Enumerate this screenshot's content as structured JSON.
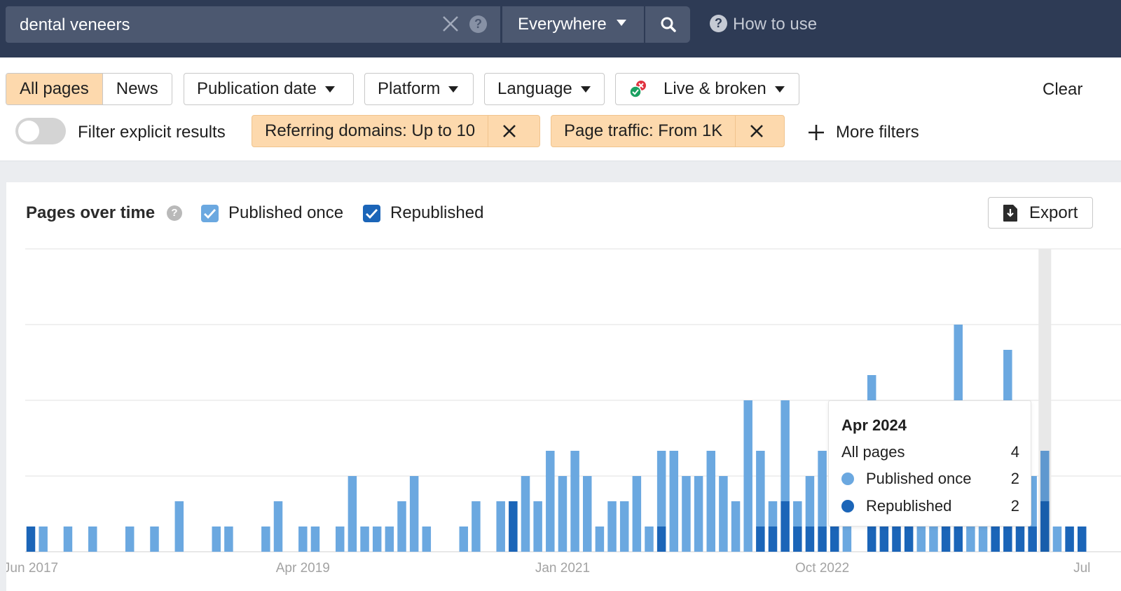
{
  "search": {
    "query": "dental veneers",
    "scope": "Everywhere",
    "how_to_use": "How to use"
  },
  "filters": {
    "segment": [
      {
        "label": "All pages",
        "active": true
      },
      {
        "label": "News",
        "active": false
      }
    ],
    "dropdowns": [
      {
        "label": "Publication date"
      },
      {
        "label": "Platform"
      },
      {
        "label": "Language"
      },
      {
        "label": "Live & broken"
      }
    ],
    "clear_label": "Clear",
    "explicit_toggle": {
      "label": "Filter explicit results",
      "on": false
    },
    "chips": [
      {
        "label": "Referring domains: Up to 10"
      },
      {
        "label": "Page traffic: From 1K"
      }
    ],
    "more_filters": "More filters"
  },
  "card": {
    "title": "Pages over time",
    "legend": [
      {
        "label": "Published once",
        "checked": true,
        "color": "#6ba8e0"
      },
      {
        "label": "Republished",
        "checked": true,
        "color": "#1b65b8"
      }
    ],
    "export_label": "Export"
  },
  "tooltip": {
    "title": "Apr 2024",
    "rows": [
      {
        "label": "All pages",
        "value": "4"
      },
      {
        "label": "Published once",
        "value": "2"
      },
      {
        "label": "Republished",
        "value": "2"
      }
    ]
  },
  "chart_data": {
    "type": "bar",
    "stacked": true,
    "title": "Pages over time",
    "x_start": "Jun 2017",
    "x_end": "Jul 2024",
    "x_tick_labels": [
      {
        "label": "Jun 2017",
        "index": 0
      },
      {
        "label": "Apr 2019",
        "index": 22
      },
      {
        "label": "Jan 2021",
        "index": 43
      },
      {
        "label": "Oct 2022",
        "index": 64
      },
      {
        "label": "Jul",
        "index": 85
      }
    ],
    "ylim": [
      0,
      12
    ],
    "grid_step": 3,
    "grid": true,
    "highlighted_index": 82,
    "series": [
      {
        "name": "Republished",
        "color": "#1b65b8",
        "values": [
          1,
          0,
          0,
          0,
          0,
          0,
          0,
          0,
          0,
          0,
          0,
          0,
          0,
          0,
          0,
          0,
          0,
          0,
          0,
          0,
          0,
          0,
          0,
          0,
          0,
          0,
          0,
          0,
          0,
          0,
          0,
          0,
          0,
          0,
          0,
          0,
          0,
          0,
          0,
          2,
          0,
          0,
          0,
          0,
          0,
          0,
          0,
          0,
          0,
          0,
          0,
          1,
          0,
          0,
          0,
          0,
          0,
          0,
          0,
          1,
          1,
          2,
          1,
          1,
          1,
          1,
          0,
          0,
          1,
          1,
          1,
          1,
          0,
          0,
          1,
          1,
          0,
          0,
          1,
          1,
          1,
          1,
          2,
          0,
          1,
          1
        ]
      },
      {
        "name": "Published once",
        "color": "#6ba8e0",
        "values": [
          0,
          1,
          0,
          1,
          0,
          1,
          0,
          0,
          1,
          0,
          1,
          0,
          2,
          0,
          0,
          1,
          1,
          0,
          0,
          1,
          2,
          0,
          1,
          1,
          0,
          1,
          3,
          1,
          1,
          1,
          2,
          3,
          1,
          0,
          0,
          1,
          2,
          0,
          2,
          0,
          3,
          2,
          4,
          3,
          4,
          3,
          1,
          2,
          2,
          3,
          1,
          3,
          4,
          3,
          3,
          4,
          3,
          2,
          6,
          3,
          1,
          4,
          1,
          2,
          3,
          0,
          1,
          0,
          6,
          0,
          0,
          0,
          1,
          1,
          0,
          8,
          1,
          1,
          0,
          7,
          0,
          2,
          2,
          1,
          0,
          0
        ]
      }
    ]
  }
}
